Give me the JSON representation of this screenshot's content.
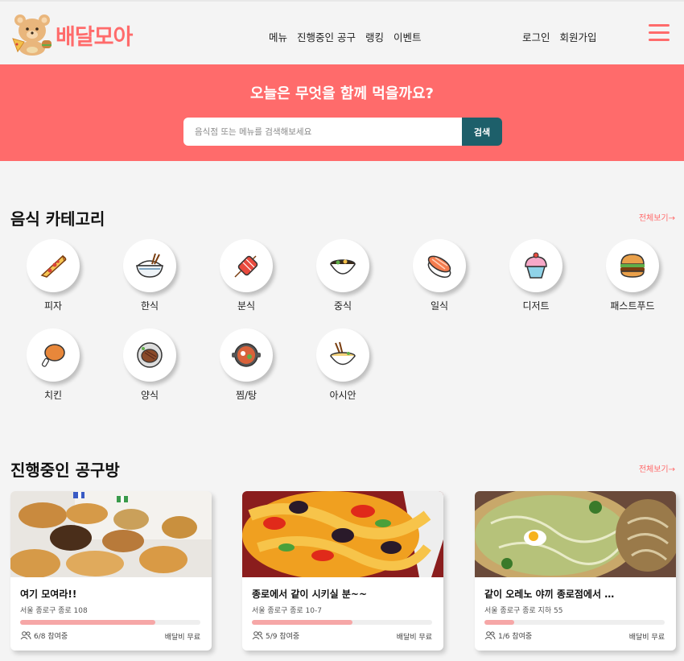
{
  "header": {
    "brand": "배달모아",
    "logo_icon": "teddy-bear-food-icon",
    "nav": [
      "메뉴",
      "진행중인 공구",
      "랭킹",
      "이벤트"
    ],
    "login": "로그인",
    "signup": "회원가입",
    "menu_icon": "hamburger-menu-icon"
  },
  "hero": {
    "title": "오늘은 무엇을 함께 먹을까요?",
    "search_placeholder": "음식점 또는 메뉴를 검색해보세요",
    "search_button": "검색"
  },
  "categories": {
    "title": "음식 카테고리",
    "see_all": "전체보기→",
    "items": [
      {
        "label": "피자",
        "icon": "pizza-icon"
      },
      {
        "label": "한식",
        "icon": "rice-bowl-icon"
      },
      {
        "label": "분식",
        "icon": "tteokbokki-skewer-icon"
      },
      {
        "label": "중식",
        "icon": "noodle-bowl-icon"
      },
      {
        "label": "일식",
        "icon": "sushi-icon"
      },
      {
        "label": "디저트",
        "icon": "cupcake-icon"
      },
      {
        "label": "패스트푸드",
        "icon": "burger-icon"
      },
      {
        "label": "치킨",
        "icon": "fried-chicken-icon"
      },
      {
        "label": "양식",
        "icon": "steak-icon"
      },
      {
        "label": "찜/탕",
        "icon": "hot-pot-icon"
      },
      {
        "label": "아시안",
        "icon": "asian-noodles-icon"
      }
    ]
  },
  "groups": {
    "title": "진행중인 공구방",
    "see_all": "전체보기→",
    "cards": [
      {
        "title": "여기 모여라!!",
        "address": "서울 종로구 종로 108",
        "participants": "6/8 참여중",
        "progress": 0.75,
        "fee": "배달비 무료",
        "image": "bread-photo"
      },
      {
        "title": "종로에서 같이 시키실 분~~",
        "address": "서울 종로구 종로 10-7",
        "participants": "5/9 참여중",
        "progress": 0.556,
        "fee": "배달비 무료",
        "image": "stir-fry-photo"
      },
      {
        "title": "같이 오레노 야끼 종로점에서 …",
        "address": "서울 종로구 종로 지하 55",
        "participants": "1/6 참여중",
        "progress": 0.167,
        "fee": "배달비 무료",
        "image": "okonomiyaki-photo"
      }
    ]
  },
  "colors": {
    "accent": "#ff6b6b",
    "search_button": "#1d5f6a",
    "progress": "#f6a7a7"
  }
}
